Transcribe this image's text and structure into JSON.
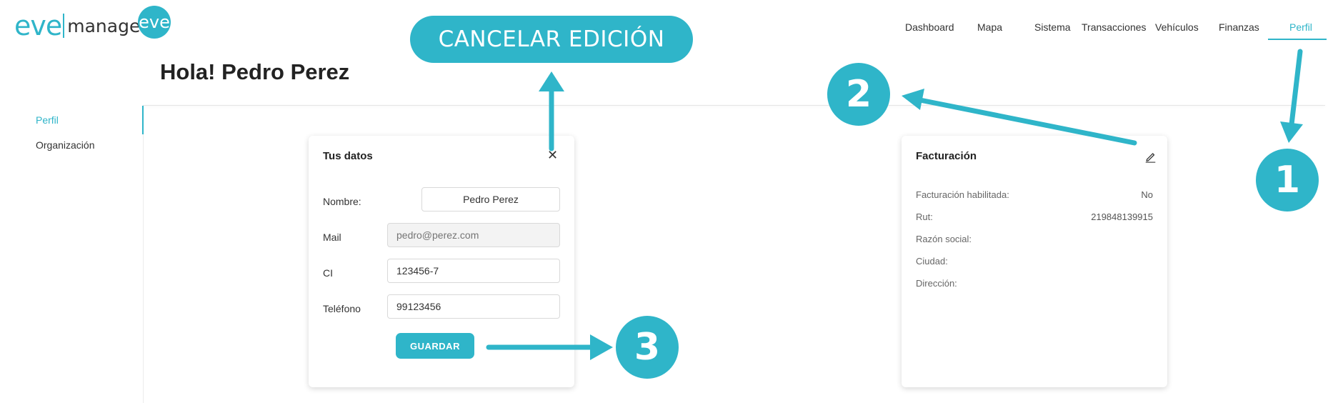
{
  "app": {
    "logo_main": "eve",
    "logo_suffix": "manager",
    "logo_badge": "eve"
  },
  "nav": [
    {
      "label": "Dashboard",
      "active": false
    },
    {
      "label": "Mapa",
      "active": false
    },
    {
      "label": "Sistema",
      "active": false
    },
    {
      "label": "Transacciones",
      "active": false
    },
    {
      "label": "Vehículos",
      "active": false
    },
    {
      "label": "Finanzas",
      "active": false
    },
    {
      "label": "Perfil",
      "active": true
    }
  ],
  "page": {
    "title": "Hola! Pedro Perez"
  },
  "sidebar": {
    "items": [
      {
        "label": "Perfil",
        "active": true
      },
      {
        "label": "Organización",
        "active": false
      }
    ]
  },
  "profile_card": {
    "title": "Tus datos",
    "close_icon": "close-icon",
    "fields": {
      "nombre": {
        "label": "Nombre:",
        "value": "Pedro Perez"
      },
      "mail": {
        "label": "Mail",
        "placeholder": "pedro@perez.com",
        "disabled": true
      },
      "ci": {
        "label": "CI",
        "value": "123456-7"
      },
      "telefono": {
        "label": "Teléfono",
        "value": "99123456"
      }
    },
    "save_label": "GUARDAR"
  },
  "billing_card": {
    "title": "Facturación",
    "edit_icon": "pencil-icon",
    "rows": [
      {
        "label": "Facturación habilitada:",
        "value": "No"
      },
      {
        "label": "Rut:",
        "value": "219848139915"
      },
      {
        "label": "Razón social:",
        "value": ""
      },
      {
        "label": "Ciudad:",
        "value": ""
      },
      {
        "label": "Dirección:",
        "value": ""
      }
    ]
  },
  "annotations": {
    "cancel_edit": "CANCELAR EDICIÓN",
    "step_1": "1",
    "step_2": "2",
    "step_3": "3"
  },
  "colors": {
    "accent": "#2fb5c9",
    "text": "#222222",
    "muted": "#666666"
  }
}
